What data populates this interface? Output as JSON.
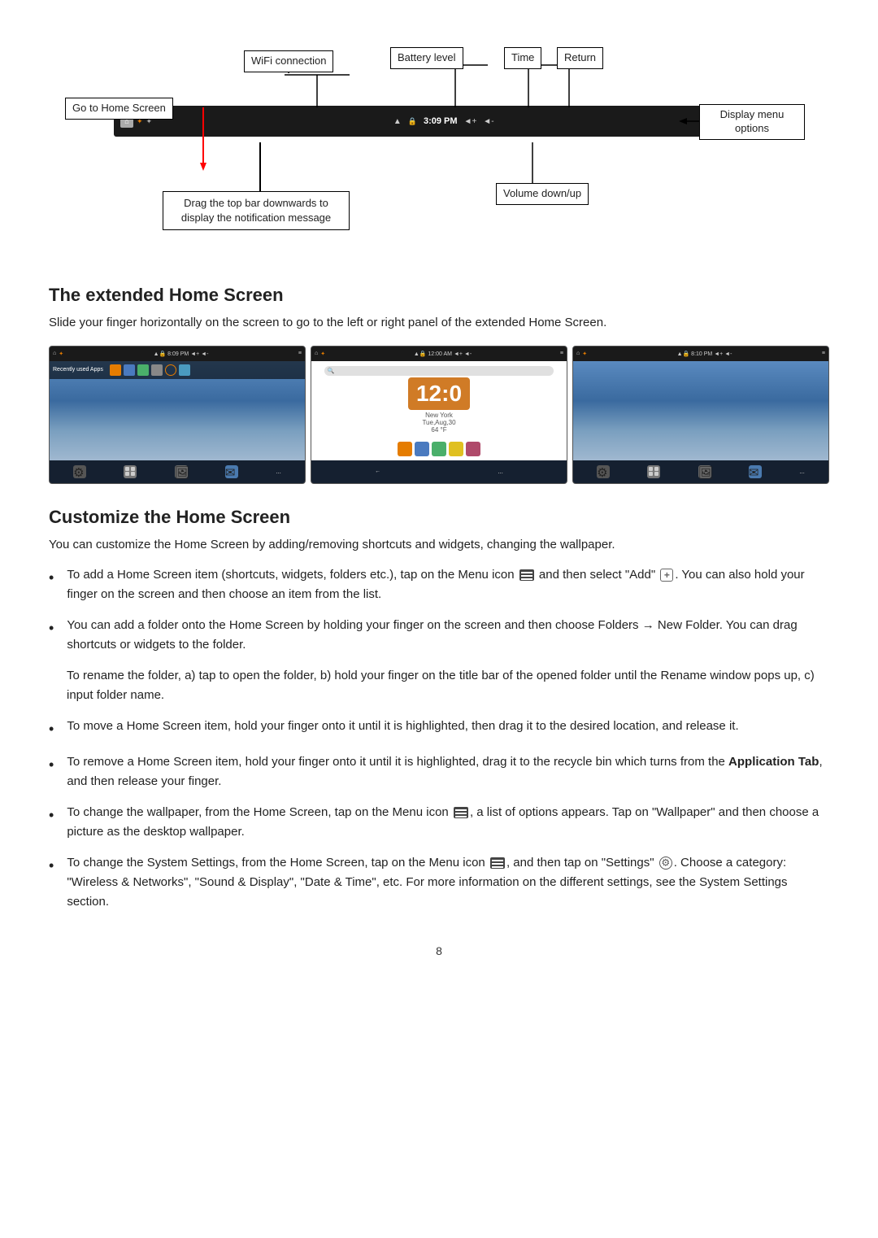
{
  "diagram": {
    "labels": {
      "wifi": "WiFi connection",
      "battery": "Battery level",
      "time": "Time",
      "return": "Return",
      "home": "Go to Home Screen",
      "display_menu": "Display menu\noptions",
      "drag_notif": "Drag the top bar downwards to\ndisplay the notification message",
      "volume": "Volume\ndown/up"
    },
    "statusbar_time": "3:09 PM"
  },
  "extended_home": {
    "title": "The extended Home Screen",
    "intro": "Slide your finger horizontally on the screen to go to the left or right panel of the extended Home Screen.",
    "clock_time": "12:0",
    "clock_date": "Tue,Aug,30",
    "clock_temp": "64 °F",
    "clock_city": "New York"
  },
  "customize": {
    "title": "Customize the Home Screen",
    "intro": "You can customize the Home Screen by adding/removing shortcuts and widgets, changing the wallpaper.",
    "bullets": [
      {
        "id": "b1",
        "text": "To add a Home Screen item (shortcuts, widgets, folders etc.), tap on the Menu icon [menu] and then select “Add” [add]. You can also hold your finger on the screen and then choose an item from the list."
      },
      {
        "id": "b2",
        "text": "You can add a folder onto the Home Screen by holding your finger on the screen and then choose Folders → New Folder. You can drag shortcuts or widgets to the folder."
      },
      {
        "id": "b2_indent",
        "text": "To rename the folder, a) tap to open the folder, b) hold your finger on the title bar of the opened folder until the Rename window pops up, c) input folder name."
      },
      {
        "id": "b3",
        "text": "To move a Home Screen item, hold your finger onto it until it is highlighted, then drag it to the desired location, and release it."
      },
      {
        "id": "b4",
        "text": "To remove a Home Screen item, hold your finger onto it until it is highlighted, drag it to the recycle bin which turns from the Application Tab, and then release your finger."
      },
      {
        "id": "b5",
        "text": "To change the wallpaper, from the Home Screen, tap on the Menu icon [menu], a list of options appears. Tap on “Wallpaper” and then choose a picture as the desktop wallpaper."
      },
      {
        "id": "b6",
        "text": "To change the System Settings, from the Home Screen, tap on the Menu icon [menu], and then tap on “Settings” [settings]. Choose a category: “Wireless & Networks”, “Sound & Display”, “Date & Time”, etc. For more information on the different settings, see the System Settings section."
      }
    ]
  },
  "page_number": "8"
}
